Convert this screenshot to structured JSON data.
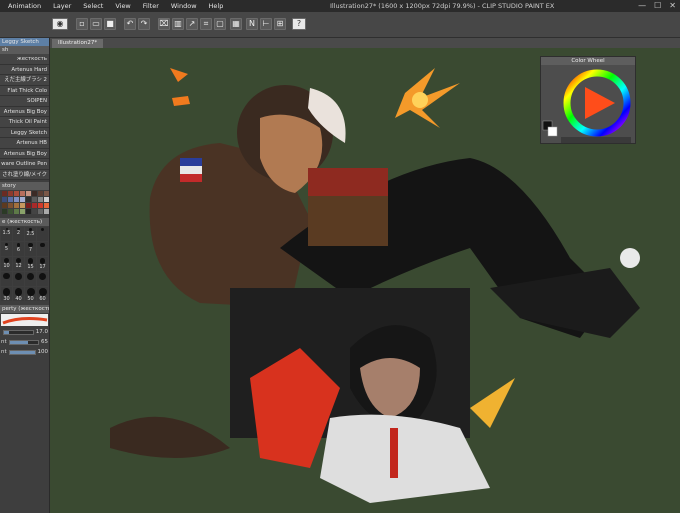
{
  "app": {
    "window_title": "Illustration27* (1600 x 1200px 72dpi 79.9%) - CLIP STUDIO PAINT EX",
    "menu": [
      "Animation",
      "Layer",
      "Select",
      "View",
      "Filter",
      "Window",
      "Help"
    ],
    "window_controls": [
      "—",
      "☐",
      "✕"
    ]
  },
  "toolbar": {
    "help_label": "?"
  },
  "canvas": {
    "tab_label": "Illustration27*",
    "background_color": "#3a4a31"
  },
  "left_panel": {
    "sub_tool_header": "Leggy Sketch",
    "sub_tool_tab": "sh",
    "brushes": [
      {
        "label": "жесткость",
        "stroke": false
      },
      {
        "label": "Artenus Hard",
        "stroke": false
      },
      {
        "label": "えだ主線ブラシ 2",
        "stroke": false
      },
      {
        "label": "Flat Thick Colo",
        "stroke": false
      },
      {
        "label": "SOIPEN",
        "stroke": false
      },
      {
        "label": "Artenus Big Boy",
        "stroke": false
      },
      {
        "label": "Thick Oil Paint",
        "stroke": false
      },
      {
        "label": "Leggy Sketch",
        "stroke": false
      },
      {
        "label": "Artenus HB",
        "stroke": false
      },
      {
        "label": "Artenus Big Boy",
        "stroke": false
      },
      {
        "label": "ware Outline Pen",
        "stroke": false
      },
      {
        "label": "され塗り線/メイク",
        "stroke": false
      }
    ],
    "history_header": "story",
    "brush_size_header": "e (жесткость)",
    "brush_sizes": [
      "1.5",
      "2",
      "2.5",
      "",
      "5",
      "6",
      "7",
      "",
      "10",
      "12",
      "15",
      "17",
      "",
      "",
      "",
      "",
      "30",
      "40",
      "50",
      "60"
    ],
    "tool_property_header": "perty (жесткость)",
    "properties": [
      {
        "label": "",
        "value": "17.0",
        "fraction": 0.17
      },
      {
        "label": "nt",
        "value": "65",
        "fraction": 0.65
      },
      {
        "label": "nt",
        "value": "100",
        "fraction": 1.0
      }
    ]
  },
  "color_wheel": {
    "title": "Color Wheel",
    "main_color": "#ff4d1a",
    "sub_color": "#ffffff"
  },
  "palette_colors": [
    "#6b2b23",
    "#8d3a2d",
    "#a84c3b",
    "#b86f5e",
    "#c99584",
    "#3b2a25",
    "#5b3f34",
    "#7a5747",
    "#3b4d7c",
    "#5b6fa6",
    "#8090c3",
    "#a6b0d4",
    "#2e2e2e",
    "#5a5a5a",
    "#8a8a8a",
    "#cfcfcf",
    "#5e3a1f",
    "#7d5130",
    "#a3703e",
    "#c6985f",
    "#7a1e1e",
    "#a92a2a",
    "#d03a2a",
    "#e8683a",
    "#2b3a26",
    "#3e5433",
    "#5e7a48",
    "#8aa36a",
    "#222",
    "#444",
    "#666",
    "#aaa"
  ]
}
